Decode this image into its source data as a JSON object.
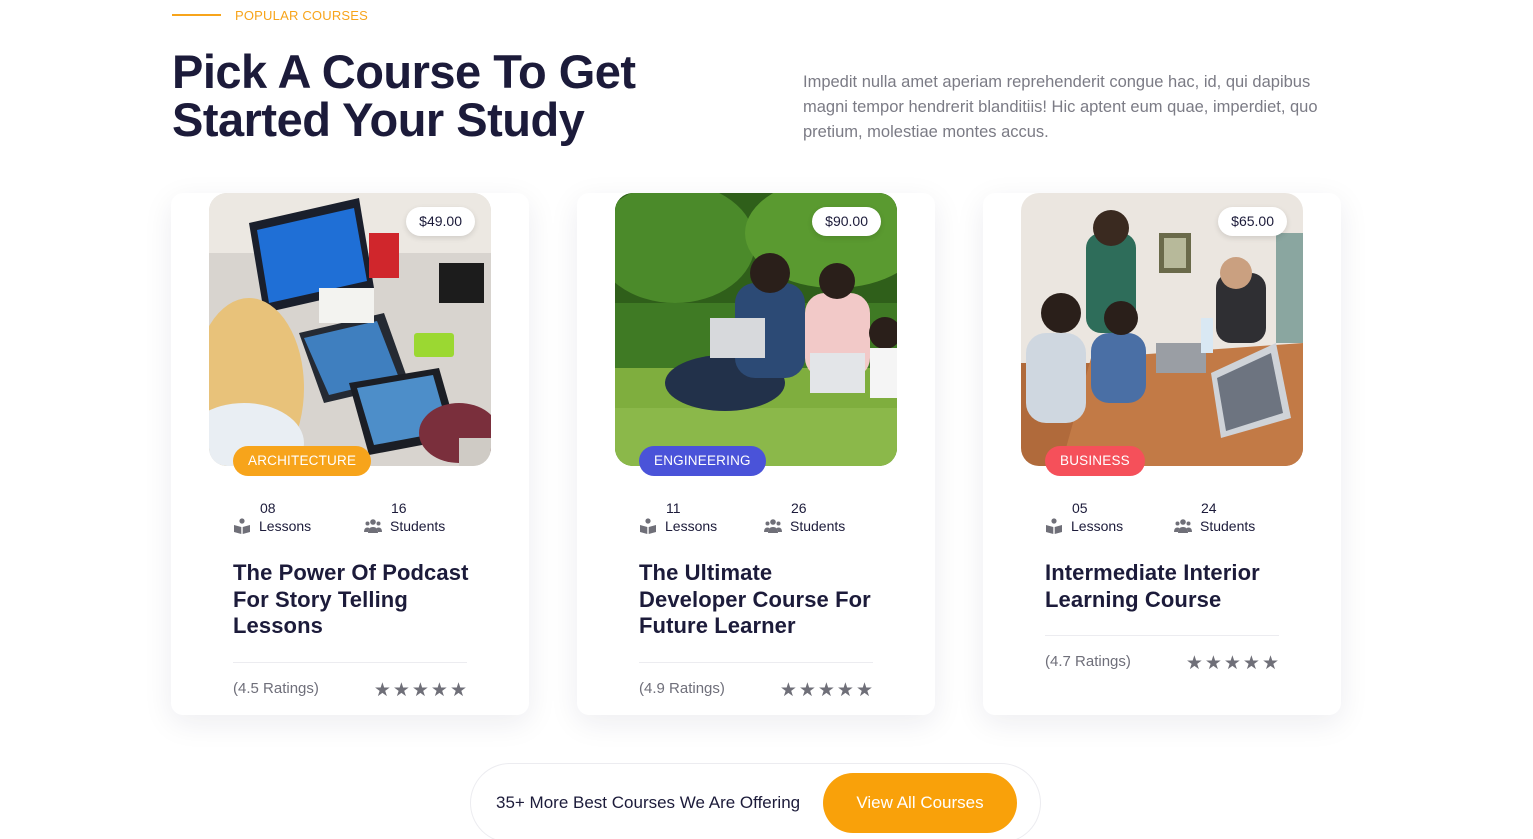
{
  "section": {
    "eyebrow": "POPULAR COURSES",
    "heading": "Pick A Course To Get Started Your Study",
    "intro": "Impedit nulla amet aperiam reprehenderit congue hac, id, qui dapibus magni tempor hendrerit blanditiis! Hic aptent eum quae, imperdiet, quo pretium, molestiae montes accus."
  },
  "colors": {
    "accent": "#f7a41b",
    "heading": "#1c1b3a",
    "tag_architecture": "#f7a41b",
    "tag_engineering": "#4a53d9",
    "tag_business": "#f5505a"
  },
  "courses": [
    {
      "price": "$49.00",
      "category": "ARCHITECTURE",
      "lessons_count": "08",
      "lessons_label": "Lessons",
      "students_count": "16",
      "students_label": "Students",
      "title": "The Power Of Podcast For Story Telling Lessons",
      "ratings": "(4.5 Ratings)",
      "stars": "★★★★★",
      "image": "team working on laptops"
    },
    {
      "price": "$90.00",
      "category": "ENGINEERING",
      "lessons_count": "11",
      "lessons_label": "Lessons",
      "students_count": "26",
      "students_label": "Students",
      "title": "The Ultimate Developer Course For Future Learner",
      "ratings": "(4.9 Ratings)",
      "stars": "★★★★★",
      "image": "students with laptops on grass"
    },
    {
      "price": "$65.00",
      "category": "BUSINESS",
      "lessons_count": "05",
      "lessons_label": "Lessons",
      "students_count": "24",
      "students_label": "Students",
      "title": "Intermediate Interior Learning Course",
      "ratings": "(4.7 Ratings)",
      "stars": "★★★★★",
      "image": "group meeting around a table"
    }
  ],
  "icons": {
    "lessons": "book-reader-icon",
    "students": "users-icon",
    "rating": "star-icon"
  },
  "cta": {
    "text": "35+ More Best Courses We Are Offering",
    "button": "View All Courses"
  }
}
